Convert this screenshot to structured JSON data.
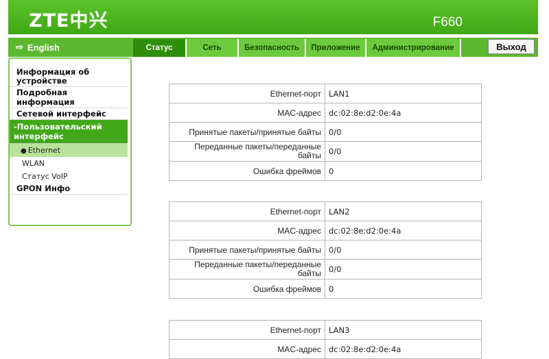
{
  "header": {
    "logo": "ZTE中兴",
    "model": "F660"
  },
  "language": {
    "label": "English"
  },
  "tabs": [
    "Статус",
    "Сеть",
    "Безопасность",
    "Приложение",
    "Администрирование"
  ],
  "logout_label": "Выход",
  "sidebar": {
    "items": [
      {
        "label": "Информация об устройстве"
      },
      {
        "label": "Подробная информация"
      },
      {
        "label": "Сетевой интерфейс"
      },
      {
        "label": "-Пользовательский интерфейс"
      },
      {
        "label": "GPON Инфо"
      }
    ],
    "subitems": [
      {
        "label": "Ethernet"
      },
      {
        "label": "WLAN"
      },
      {
        "label": "Статус VoIP"
      }
    ]
  },
  "ports": [
    {
      "port_label": "Ethernet-порт",
      "port": "LAN1",
      "mac_label": "MAC-адрес",
      "mac": "dc:02:8e:d2:0e:4a",
      "rx_label": "Принятые пакеты/принятые байты",
      "rx": "0/0",
      "tx_label": "Переданные пакеты/переданные байты",
      "tx": "0/0",
      "err_label": "Ошибка фреймов",
      "err": "0"
    },
    {
      "port_label": "Ethernet-порт",
      "port": "LAN2",
      "mac_label": "MAC-адрес",
      "mac": "dc:02:8e:d2:0e:4a",
      "rx_label": "Принятые пакеты/принятые байты",
      "rx": "0/0",
      "tx_label": "Переданные пакеты/переданные байты",
      "tx": "0/0",
      "err_label": "Ошибка фреймов",
      "err": "0"
    },
    {
      "port_label": "Ethernet-порт",
      "port": "LAN3",
      "mac_label": "MAC-адрес",
      "mac": "dc:02:8e:d2:0e:4a"
    }
  ],
  "colors": {
    "brand_green": "#3fa814",
    "active_tab": "#2e8e0a",
    "selected_sub": "#b9e39b"
  }
}
